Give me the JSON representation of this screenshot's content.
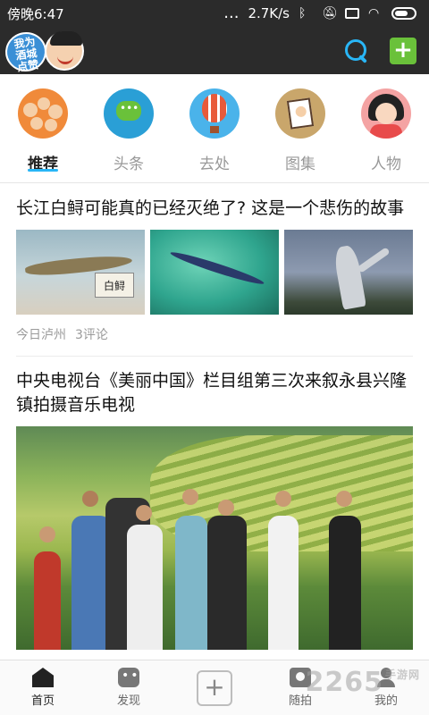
{
  "status_bar": {
    "time": "傍晚6:47",
    "dots": "...",
    "speed": "2.7K/s"
  },
  "app_bar": {
    "logo_text": "我为酒城点赞",
    "colors": {
      "background": "#2b2b2b",
      "search": "#29b6f6",
      "add": "#6ac13a"
    }
  },
  "categories": [
    {
      "label": "推荐",
      "icon": "people-group-icon",
      "active": true
    },
    {
      "label": "头条",
      "icon": "chat-bubble-icon",
      "active": false
    },
    {
      "label": "去处",
      "icon": "hot-air-balloon-icon",
      "active": false
    },
    {
      "label": "图集",
      "icon": "photo-icon",
      "active": false
    },
    {
      "label": "人物",
      "icon": "person-icon",
      "active": false
    }
  ],
  "feed": {
    "articles": [
      {
        "title": "长江白鲟可能真的已经灭绝了? 这是一个悲伤的故事",
        "image_caption": "白鲟",
        "source": "今日泸州",
        "comments": "3评论"
      },
      {
        "title": "中央电视台《美丽中国》栏目组第三次来叙永县兴隆镇拍摄音乐电视"
      }
    ]
  },
  "bottom_nav": [
    {
      "label": "首页",
      "icon": "home-icon",
      "active": true
    },
    {
      "label": "发现",
      "icon": "discover-icon",
      "active": false
    },
    {
      "label": "",
      "icon": "plus-icon",
      "active": false
    },
    {
      "label": "随拍",
      "icon": "camera-icon",
      "active": false
    },
    {
      "label": "我的",
      "icon": "user-icon",
      "active": false
    }
  ],
  "watermark": {
    "text": "2265",
    "suffix": "手游网"
  }
}
